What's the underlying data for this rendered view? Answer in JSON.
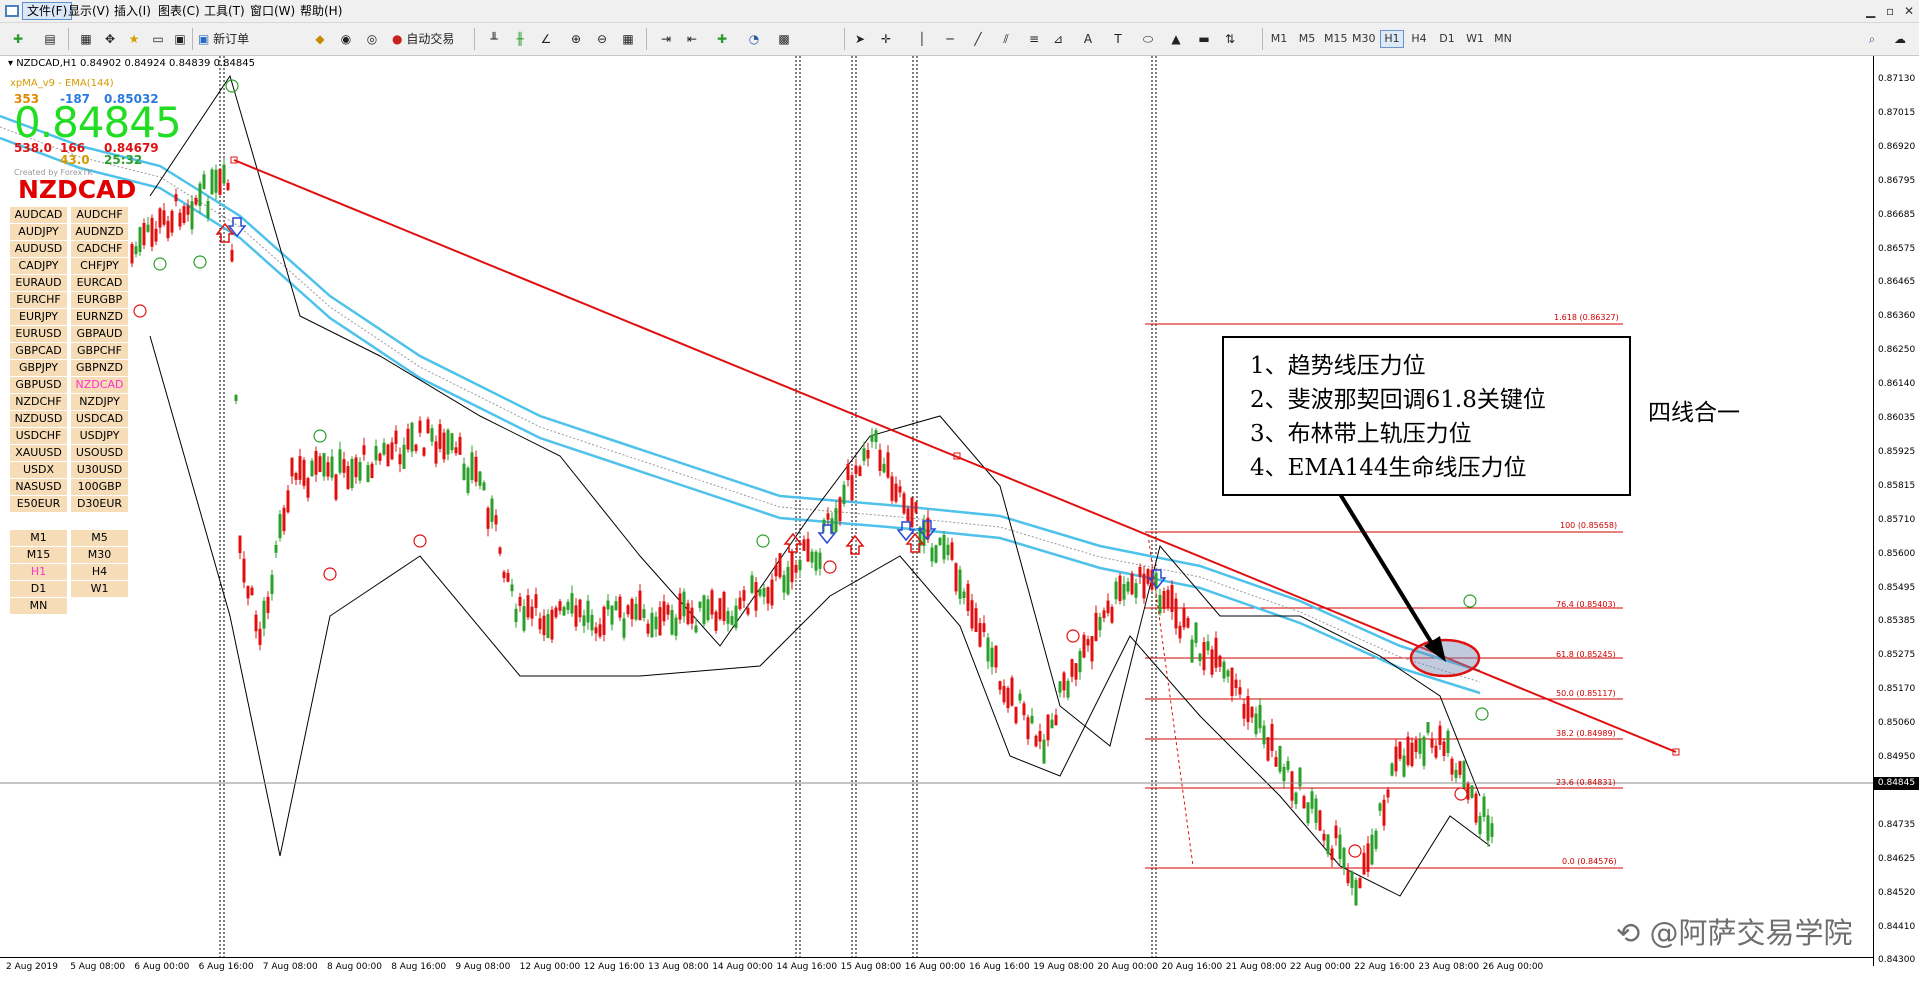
{
  "menu": {
    "items": [
      "文件(F)",
      "显示(V)",
      "插入(I)",
      "图表(C)",
      "工具(T)",
      "窗口(W)",
      "帮助(H)"
    ]
  },
  "toolbar": {
    "new_order": "新订单",
    "auto_trade": "自动交易"
  },
  "timeframes": [
    "M1",
    "M5",
    "M15",
    "M30",
    "H1",
    "H4",
    "D1",
    "W1",
    "MN"
  ],
  "selected_timeframe": "H1",
  "chart": {
    "header": "NZDCAD,H1  0.84902 0.84924 0.84839 0.84845",
    "indicator": "xpMA_v9 - EMA(144)",
    "stats1": [
      "353",
      "-187",
      "0.85032"
    ],
    "big_price": "0.84845",
    "stats2": [
      "538.0",
      "166",
      "0.84679"
    ],
    "stats3": [
      "43.0",
      "25:32"
    ],
    "created_by": "Created by ForexTK",
    "symbol": "NZDCAD"
  },
  "pairs": [
    "AUDCAD",
    "AUDCHF",
    "AUDJPY",
    "AUDNZD",
    "AUDUSD",
    "CADCHF",
    "CADJPY",
    "CHFJPY",
    "EURAUD",
    "EURCAD",
    "EURCHF",
    "EURGBP",
    "EURJPY",
    "EURNZD",
    "EURUSD",
    "GBPAUD",
    "GBPCAD",
    "GBPCHF",
    "GBPJPY",
    "GBPNZD",
    "GBPUSD",
    "NZDCAD",
    "NZDCHF",
    "NZDJPY",
    "NZDUSD",
    "USDCAD",
    "USDCHF",
    "USDJPY",
    "XAUUSD",
    "USOUSD",
    "USDX",
    "U30USD",
    "NASUSD",
    "100GBP",
    "E50EUR",
    "D30EUR"
  ],
  "selected_pair": "NZDCAD",
  "tf_buttons": [
    "M1",
    "M5",
    "M15",
    "M30",
    "H1",
    "H4",
    "D1",
    "W1",
    "MN"
  ],
  "annotation": {
    "lines": [
      "1、趋势线压力位",
      "2、斐波那契回调61.8关键位",
      "3、布林带上轨压力位",
      "4、EMA144生命线压力位"
    ],
    "side_note": "四线合一"
  },
  "fib_levels": [
    {
      "label": "1.618 (0.86327)"
    },
    {
      "label": "100 (0.85658)"
    },
    {
      "label": "76.4 (0.85403)"
    },
    {
      "label": "61.8 (0.85245)"
    },
    {
      "label": "50.0 (0.85117)"
    },
    {
      "label": "38.2 (0.84989)"
    },
    {
      "label": "23.6 (0.84831)"
    },
    {
      "label": "0.0 (0.84576)"
    }
  ],
  "price_axis": [
    "0.87130",
    "0.87015",
    "0.86920",
    "0.86795",
    "0.86685",
    "0.86575",
    "0.86465",
    "0.86360",
    "0.86250",
    "0.86140",
    "0.86035",
    "0.85925",
    "0.85815",
    "0.85710",
    "0.85600",
    "0.85495",
    "0.85385",
    "0.85275",
    "0.85170",
    "0.85060",
    "0.84950",
    "0.84845",
    "0.84735",
    "0.84625",
    "0.84520",
    "0.84410",
    "0.84300"
  ],
  "current_price": "0.84845",
  "time_axis": [
    "2 Aug 2019",
    "5 Aug 08:00",
    "6 Aug 00:00",
    "6 Aug 16:00",
    "7 Aug 08:00",
    "8 Aug 00:00",
    "8 Aug 16:00",
    "9 Aug 08:00",
    "12 Aug 00:00",
    "12 Aug 16:00",
    "13 Aug 08:00",
    "14 Aug 00:00",
    "14 Aug 16:00",
    "15 Aug 08:00",
    "16 Aug 00:00",
    "16 Aug 16:00",
    "19 Aug 08:00",
    "20 Aug 00:00",
    "20 Aug 16:00",
    "21 Aug 08:00",
    "22 Aug 00:00",
    "22 Aug 16:00",
    "23 Aug 08:00",
    "26 Aug 00:00"
  ],
  "watermark": "阿萨交易学院"
}
